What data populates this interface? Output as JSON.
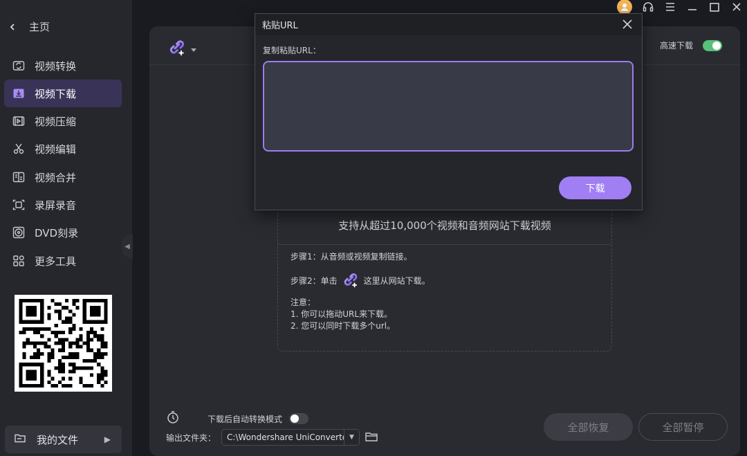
{
  "sidebar": {
    "home_label": "主页",
    "items": [
      {
        "label": "视频转换",
        "icon": "video-convert-icon"
      },
      {
        "label": "视频下载",
        "icon": "video-download-icon",
        "active": true
      },
      {
        "label": "视频压缩",
        "icon": "video-compress-icon"
      },
      {
        "label": "视频编辑",
        "icon": "scissors-icon"
      },
      {
        "label": "视频合并",
        "icon": "video-merge-icon"
      },
      {
        "label": "录屏录音",
        "icon": "screen-record-icon"
      },
      {
        "label": "DVD刻录",
        "icon": "dvd-icon"
      },
      {
        "label": "更多工具",
        "icon": "more-tools-icon"
      }
    ],
    "my_files_label": "我的文件"
  },
  "panel": {
    "high_speed_label": "高速下载",
    "high_speed_on": true,
    "drop_title": "支持从超过10,000个视频和音频网站下载视频",
    "step1": "步骤1：从音频或视频复制链接。",
    "step2_before": "步骤2：单击",
    "step2_after": "这里从网站下载。",
    "note_title": "注意：",
    "note1": "1. 你可以拖动URL来下载。",
    "note2": "2. 您可以同时下载多个url。"
  },
  "footer": {
    "auto_convert_label": "下载后自动转换模式",
    "auto_convert_on": false,
    "output_label": "输出文件夹：",
    "output_path": "C:\\Wondershare UniConverter",
    "resume_all": "全部恢复",
    "pause_all": "全部暂停"
  },
  "dialog": {
    "title": "粘贴URL",
    "label": "复制粘贴URL：",
    "url_value": "",
    "download_button": "下载"
  },
  "colors": {
    "accent": "#a07ef3",
    "toggle_on": "#57c17b",
    "avatar": "#f5b65a"
  }
}
